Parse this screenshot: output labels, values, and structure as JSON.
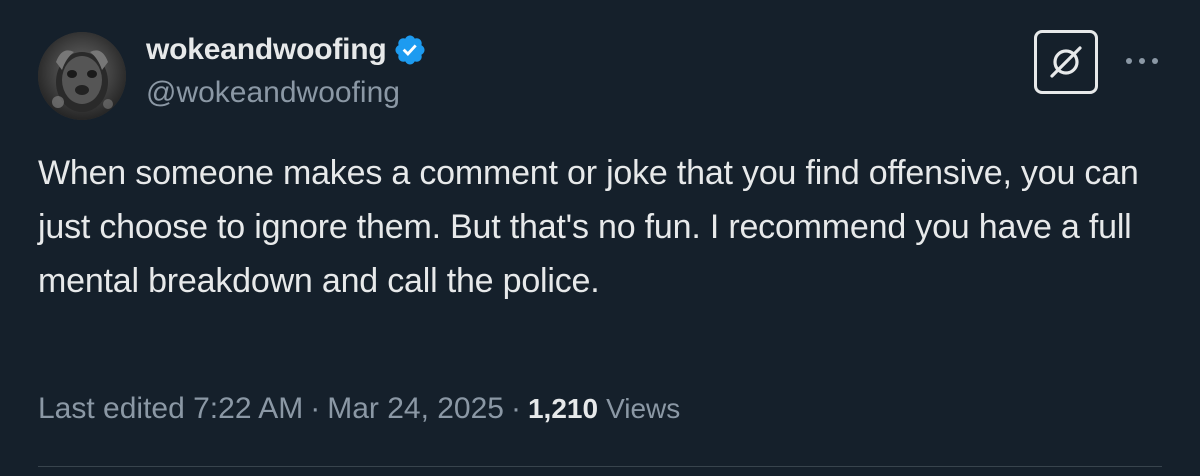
{
  "author": {
    "display_name": "wokeandwoofing",
    "handle": "@wokeandwoofing",
    "verified": true,
    "verified_icon": "verified-badge-icon",
    "avatar": "avatar-image"
  },
  "tweet": {
    "text": "When someone makes a comment or joke that you find offensive, you can just choose to ignore them. But that's no fun. I recommend you have a full mental breakdown and call the police.",
    "edited_label": "Last edited",
    "time": "7:22 AM",
    "date": "Mar 24, 2025",
    "separator": "·",
    "views_count": "1,210",
    "views_label": "Views"
  },
  "actions": {
    "grok_icon": "grok-icon",
    "more_icon": "more-icon"
  },
  "colors": {
    "background": "#15202b",
    "text_primary": "#e7e9ea",
    "text_secondary": "#8b98a5",
    "accent": "#1d9bf0",
    "divider": "#38444d"
  }
}
